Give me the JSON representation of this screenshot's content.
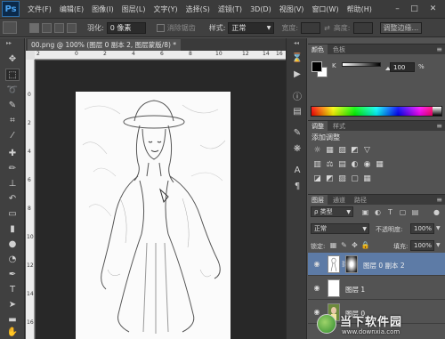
{
  "app": {
    "logo": "Ps",
    "menu": [
      "文件(F)",
      "编辑(E)",
      "图像(I)",
      "图层(L)",
      "文字(Y)",
      "选择(S)",
      "滤镜(T)",
      "3D(D)",
      "视图(V)",
      "窗口(W)",
      "帮助(H)"
    ],
    "window_controls": {
      "minimize": "–",
      "maximize": "□",
      "close": "✕"
    }
  },
  "options_bar": {
    "feather_label": "羽化:",
    "feather_value": "0 像素",
    "antialias_label": "消除锯齿",
    "style_label": "样式:",
    "style_value": "正常",
    "width_label": "宽度:",
    "height_label": "高度:",
    "refine_edge_label": "调整边缘..."
  },
  "document": {
    "tab_title": "00.png @ 100% (图层 0 副本 2, 图层蒙版/8) *",
    "tab_close": "×",
    "ruler_top": [
      "2",
      "0",
      "2",
      "4",
      "6",
      "8",
      "10",
      "12",
      "14",
      "16"
    ],
    "ruler_left": [
      "0",
      "2",
      "4",
      "6",
      "8",
      "10",
      "12",
      "14",
      "16"
    ]
  },
  "tools": [
    {
      "icon": "move-icon",
      "glyph": "✥"
    },
    {
      "icon": "rect-marquee-icon",
      "glyph": "⬚"
    },
    {
      "icon": "lasso-icon",
      "glyph": "➰"
    },
    {
      "icon": "quick-select-icon",
      "glyph": "✎"
    },
    {
      "icon": "crop-icon",
      "glyph": "⌗"
    },
    {
      "icon": "eyedropper-icon",
      "glyph": "⁄"
    },
    {
      "icon": "healing-brush-icon",
      "glyph": "✚"
    },
    {
      "icon": "brush-icon",
      "glyph": "✏"
    },
    {
      "icon": "clone-stamp-icon",
      "glyph": "⊥"
    },
    {
      "icon": "history-brush-icon",
      "glyph": "↶"
    },
    {
      "icon": "eraser-icon",
      "glyph": "▭"
    },
    {
      "icon": "gradient-icon",
      "glyph": "▮"
    },
    {
      "icon": "blur-icon",
      "glyph": "●"
    },
    {
      "icon": "dodge-icon",
      "glyph": "◔"
    },
    {
      "icon": "pen-icon",
      "glyph": "✒"
    },
    {
      "icon": "type-icon",
      "glyph": "T"
    },
    {
      "icon": "path-select-icon",
      "glyph": "➤"
    },
    {
      "icon": "shape-icon",
      "glyph": "▬"
    },
    {
      "icon": "hand-icon",
      "glyph": "✋"
    }
  ],
  "panels": {
    "color": {
      "tabs": [
        "颜色",
        "色板"
      ],
      "channel": "K",
      "value": "100",
      "unit": "%"
    },
    "adjustments": {
      "tabs": [
        "调整",
        "样式"
      ],
      "title": "添加调整",
      "row1": [
        "☼",
        "▦",
        "▨",
        "◩",
        "▽"
      ],
      "row2": [
        "▥",
        "⚖",
        "▤",
        "◐",
        "◉",
        "▦"
      ],
      "row3": [
        "◪",
        "◩",
        "▨",
        "▢",
        "▦"
      ]
    },
    "layers": {
      "tabs": [
        "图层",
        "通道",
        "路径"
      ],
      "kind_filter": "ρ 类型",
      "blend_mode": "正常",
      "opacity_label": "不透明度:",
      "opacity_value": "100%",
      "lock_label": "锁定:",
      "fill_label": "填充:",
      "fill_value": "100%",
      "items": [
        {
          "name": "图层 0 副本 2",
          "selected": true
        },
        {
          "name": "图层 1",
          "selected": false
        },
        {
          "name": "图层 0",
          "selected": false
        }
      ]
    }
  },
  "watermark": {
    "name": "当下软件园",
    "url": "www.downxia.com"
  }
}
